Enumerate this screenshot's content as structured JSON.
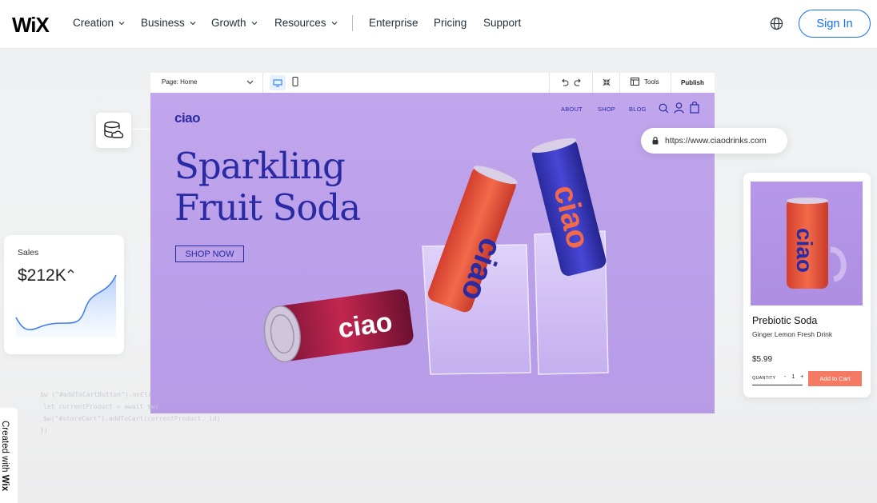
{
  "nav": {
    "logo": "WiX",
    "items": [
      "Creation",
      "Business",
      "Growth",
      "Resources"
    ],
    "links": [
      "Enterprise",
      "Pricing",
      "Support"
    ],
    "signin": "Sign In"
  },
  "editor": {
    "page_select": "Page: Home",
    "tools": "Tools",
    "publish": "Publish"
  },
  "site": {
    "brand": "ciao",
    "nav": [
      "ABOUT",
      "SHOP",
      "BLOG"
    ],
    "hero_line1": "Sparkling",
    "hero_line2": "Fruit Soda",
    "cta": "SHOP NOW",
    "can_brand": "ciao"
  },
  "url": "https://www.ciaodrinks.com",
  "sales": {
    "label": "Sales",
    "value": "$212K"
  },
  "product": {
    "name": "Prebiotic Soda",
    "subtitle": "Ginger Lemon Fresh Drink",
    "price": "$5.99",
    "qty_label": "QUANTITY",
    "qty_minus": "-",
    "qty_value": "1",
    "qty_plus": "+",
    "add_to_cart": "Add to Cart"
  },
  "code_lines": [
    "$w (\"#addToCartButton\").onCli",
    "let currentProduct = await $w(",
    "$w(\"#storeCart\").addToCart(currentProduct._id)",
    "})"
  ],
  "created_with": {
    "prefix": "Created with ",
    "brand": "Wix"
  },
  "colors": {
    "accent": "#116dff",
    "site_purple": "#c1a6ec",
    "site_ink": "#2a2aa3",
    "cart_button": "#f47a63"
  }
}
